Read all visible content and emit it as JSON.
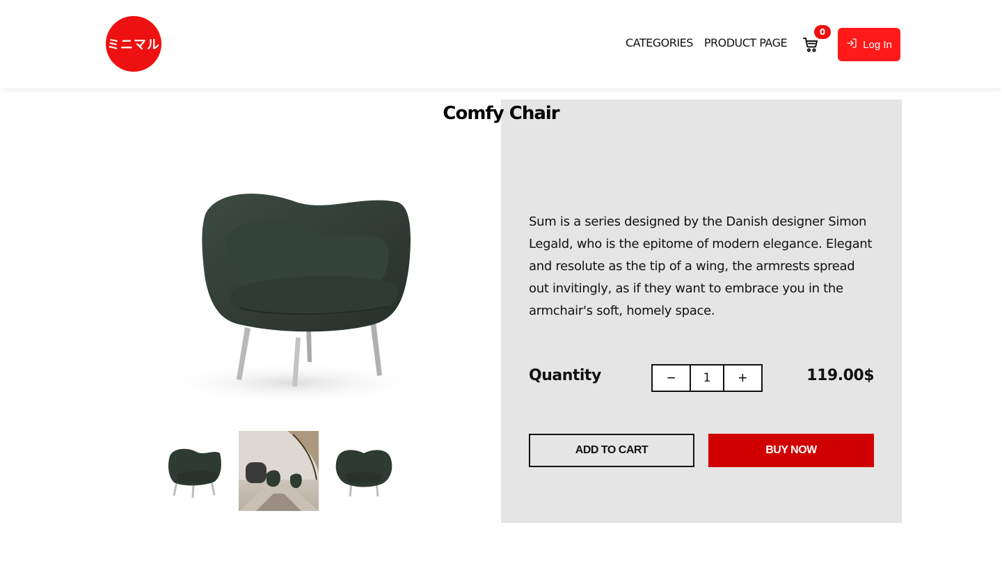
{
  "header": {
    "logo_text": "ミニマル",
    "nav": [
      {
        "label": "CATEGORIES"
      },
      {
        "label": "PRODUCT PAGE"
      }
    ],
    "cart_count": "0",
    "login_label": "Log In"
  },
  "colors": {
    "brand_red": "#ee1111",
    "buy_red": "#d10000",
    "panel_bg": "#e5e5e5",
    "chair_green": "#2e3b33"
  },
  "product": {
    "title": "Comfy Chair",
    "description": "Sum is a series designed by the Danish designer Simon Legald, who is the epitome of modern elegance. Elegant and resolute as the tip of a wing, the armrests spread out invitingly, as if they want to embrace you in the armchair's soft, homely space.",
    "quantity_label": "Quantity",
    "quantity_value": "1",
    "decrement_label": "−",
    "increment_label": "+",
    "price": "119.00$",
    "add_to_cart_label": "ADD TO CART",
    "buy_now_label": "BUY NOW"
  },
  "icons": {
    "cart": "cart-icon",
    "login": "login-icon"
  }
}
